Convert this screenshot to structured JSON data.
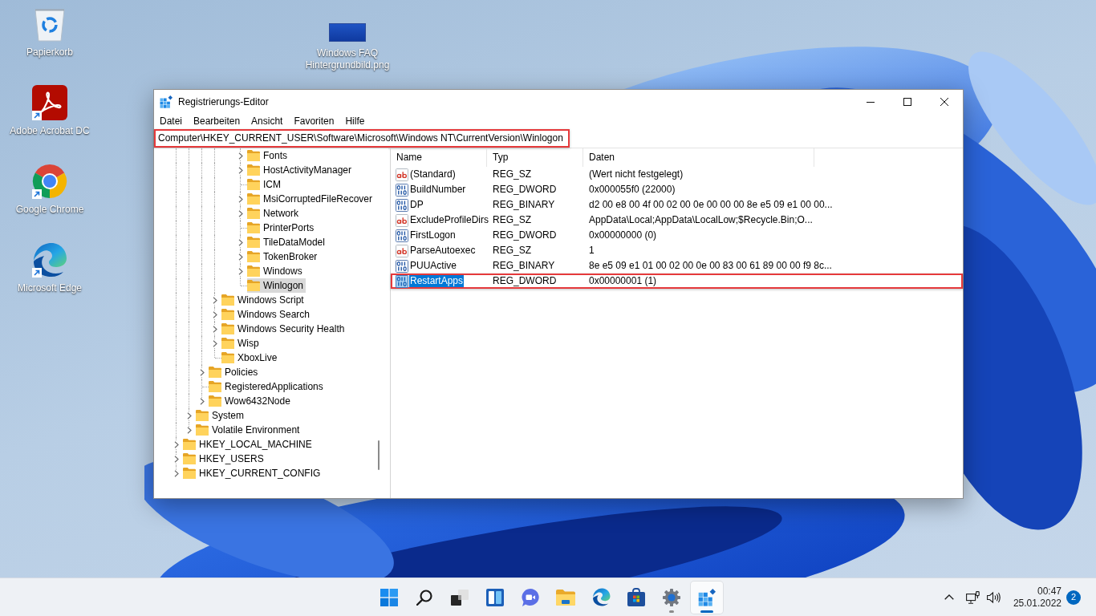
{
  "desktop": {
    "icons": [
      {
        "kind": "recycle_bin",
        "label": "Papierkorb",
        "shortcut": false
      },
      {
        "kind": "pdf",
        "label": "Adobe Acrobat DC",
        "shortcut": true
      },
      {
        "kind": "chrome",
        "label": "Google Chrome",
        "shortcut": true
      },
      {
        "kind": "edge",
        "label": "Microsoft Edge",
        "shortcut": true
      }
    ],
    "file": {
      "label": "Windows FAQ Hintergrundbild.png"
    }
  },
  "window": {
    "title": "Registrierungs-Editor",
    "menu": [
      "Datei",
      "Bearbeiten",
      "Ansicht",
      "Favoriten",
      "Hilfe"
    ],
    "address": {
      "value": "Computer\\HKEY_CURRENT_USER\\Software\\Microsoft\\Windows NT\\CurrentVersion\\Winlogon",
      "highlighted": true
    },
    "tree": {
      "items": [
        {
          "children": [
            {
              "children": [
                {
                  "children": [
                    {
                      "children": [
                        {
                          "children": [
                            {
                              "label": "Fonts",
                              "expandable": true,
                              "selected": false
                            },
                            {
                              "label": "HostActivityManager",
                              "expandable": true,
                              "selected": false
                            },
                            {
                              "label": "ICM",
                              "expandable": false,
                              "selected": false
                            },
                            {
                              "label": "MsiCorruptedFileRecover",
                              "expandable": true,
                              "selected": false
                            },
                            {
                              "label": "Network",
                              "expandable": true,
                              "selected": false
                            },
                            {
                              "label": "PrinterPorts",
                              "expandable": false,
                              "selected": false
                            },
                            {
                              "label": "TileDataModel",
                              "expandable": true,
                              "selected": false
                            },
                            {
                              "label": "TokenBroker",
                              "expandable": true,
                              "selected": false
                            },
                            {
                              "label": "Windows",
                              "expandable": true,
                              "selected": false
                            },
                            {
                              "label": "Winlogon",
                              "expandable": false,
                              "selected": true
                            }
                          ]
                        }
                      ]
                    },
                    {
                      "label": "Windows Script",
                      "expandable": true,
                      "selected": false
                    },
                    {
                      "label": "Windows Search",
                      "expandable": true,
                      "selected": false
                    },
                    {
                      "label": "Windows Security Health",
                      "expandable": true,
                      "selected": false
                    },
                    {
                      "label": "Wisp",
                      "expandable": true,
                      "selected": false
                    },
                    {
                      "label": "XboxLive",
                      "expandable": false,
                      "selected": false
                    }
                  ]
                },
                {
                  "label": "Policies",
                  "expandable": true,
                  "selected": false
                },
                {
                  "label": "RegisteredApplications",
                  "expandable": false,
                  "selected": false
                },
                {
                  "label": "Wow6432Node",
                  "expandable": true,
                  "selected": false
                }
              ]
            },
            {
              "label": "System",
              "expandable": true,
              "selected": false
            },
            {
              "label": "Volatile Environment",
              "expandable": true,
              "selected": false
            }
          ]
        },
        {
          "label": "HKEY_LOCAL_MACHINE",
          "expandable": true,
          "selected": false
        },
        {
          "label": "HKEY_USERS",
          "expandable": true,
          "selected": false
        },
        {
          "label": "HKEY_CURRENT_CONFIG",
          "expandable": true,
          "selected": false
        }
      ]
    },
    "values": {
      "columns": [
        "Name",
        "Typ",
        "Daten"
      ],
      "rows": [
        {
          "kind": "string",
          "name": "(Standard)",
          "type": "REG_SZ",
          "data": "(Wert nicht festgelegt)",
          "selected": false,
          "highlighted": false
        },
        {
          "kind": "binary",
          "name": "BuildNumber",
          "type": "REG_DWORD",
          "data": "0x000055f0 (22000)",
          "selected": false,
          "highlighted": false
        },
        {
          "kind": "binary",
          "name": "DP",
          "type": "REG_BINARY",
          "data": "d2 00 e8 00 4f 00 02 00 0e 00 00 00 8e e5 09 e1 00 00...",
          "selected": false,
          "highlighted": false
        },
        {
          "kind": "string",
          "name": "ExcludeProfileDirs",
          "type": "REG_SZ",
          "data": "AppData\\Local;AppData\\LocalLow;$Recycle.Bin;O...",
          "selected": false,
          "highlighted": false
        },
        {
          "kind": "binary",
          "name": "FirstLogon",
          "type": "REG_DWORD",
          "data": "0x00000000 (0)",
          "selected": false,
          "highlighted": false
        },
        {
          "kind": "string",
          "name": "ParseAutoexec",
          "type": "REG_SZ",
          "data": "1",
          "selected": false,
          "highlighted": false
        },
        {
          "kind": "binary",
          "name": "PUUActive",
          "type": "REG_BINARY",
          "data": "8e e5 09 e1 01 00 02 00 0e 00 83 00 61 89 00 00 f9 8c...",
          "selected": false,
          "highlighted": false
        },
        {
          "kind": "binary",
          "name": "RestartApps",
          "type": "REG_DWORD",
          "data": "0x00000001 (1)",
          "selected": true,
          "highlighted": true
        }
      ]
    }
  },
  "taskbar": {
    "apps": [
      {
        "kind": "start",
        "running": false,
        "active": false
      },
      {
        "kind": "search",
        "running": false,
        "active": false
      },
      {
        "kind": "task_view",
        "running": false,
        "active": false
      },
      {
        "kind": "widgets",
        "running": false,
        "active": false
      },
      {
        "kind": "chat",
        "running": false,
        "active": false
      },
      {
        "kind": "explorer",
        "running": false,
        "active": false
      },
      {
        "kind": "edge",
        "running": false,
        "active": false
      },
      {
        "kind": "store",
        "running": false,
        "active": false
      },
      {
        "kind": "settings",
        "running": true,
        "active": false
      },
      {
        "kind": "regedit",
        "running": true,
        "active": true
      }
    ],
    "tray": {
      "time": "00:47",
      "date": "25.01.2022",
      "notifications": "2"
    }
  }
}
